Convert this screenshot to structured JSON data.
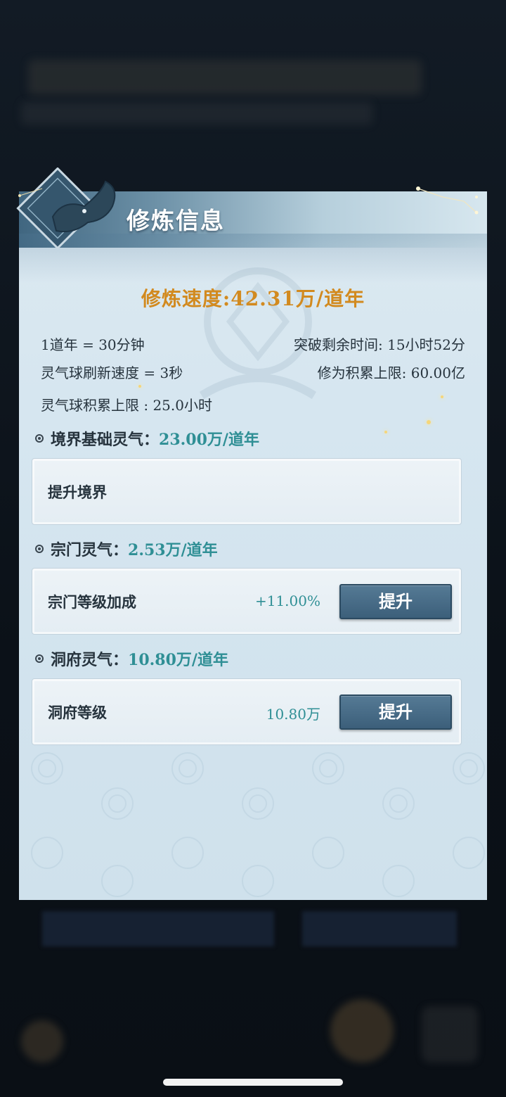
{
  "modal": {
    "title": "修炼信息",
    "speed_text": "修炼速度:42.31万/道年"
  },
  "info": {
    "dao_year": "1道年 = 30分钟",
    "breakthrough_remaining": "突破剩余时间: 15小时52分",
    "orb_refresh": "灵气球刷新速度 = 3秒",
    "cultivation_cap": "修为积累上限: 60.00亿",
    "orb_cap": "灵气球积累上限 : 25.0小时"
  },
  "sections": [
    {
      "label": "境界基础灵气：",
      "value": "23.00万/道年",
      "row_label": "提升境界",
      "row_value": "",
      "button": ""
    },
    {
      "label": "宗门灵气：",
      "value": "2.53万/道年",
      "row_label": "宗门等级加成",
      "row_value": "+11.00%",
      "button": "提升"
    },
    {
      "label": "洞府灵气：",
      "value": "10.80万/道年",
      "row_label": "洞府等级",
      "row_value": "10.80万",
      "button": "提升"
    }
  ],
  "colors": {
    "accent_orange": "#d28a1f",
    "teal_value": "#2f8f95",
    "button_blue": "#3c5f7a"
  }
}
